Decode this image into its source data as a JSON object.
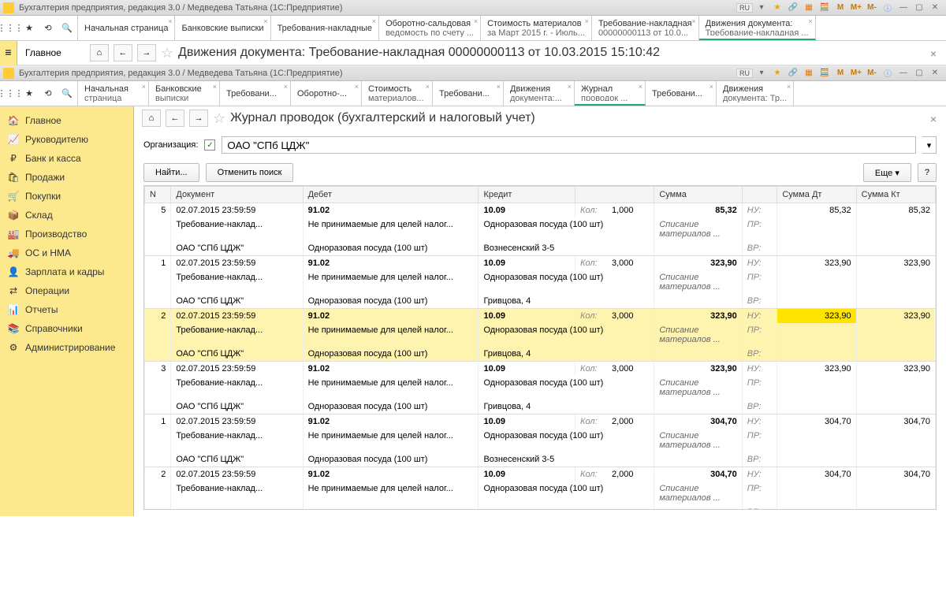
{
  "title1": "Бухгалтерия предприятия, редакция 3.0 / Медведева Татьяна  (1С:Предприятие)",
  "lang": "RU",
  "mbtns": [
    "M",
    "M+",
    "M-"
  ],
  "tabs1": [
    {
      "l1": "Начальная страница"
    },
    {
      "l1": "Банковские выписки"
    },
    {
      "l1": "Требования-накладные"
    },
    {
      "l1": "Оборотно-сальдовая",
      "l2": "ведомость по счету ..."
    },
    {
      "l1": "Стоимость материалов",
      "l2": "за Март 2015 г. - Июль..."
    },
    {
      "l1": "Требование-накладная",
      "l2": "00000000113 от 10.0..."
    },
    {
      "l1": "Движения документа:",
      "l2": "Требование-накладная ...",
      "active": true
    }
  ],
  "doc_title1": "Движения документа: Требование-накладная 00000000113 от 10.03.2015 15:10:42",
  "tabs2": [
    {
      "l1": "Начальная",
      "l2": "страница"
    },
    {
      "l1": "Банковские",
      "l2": "выписки"
    },
    {
      "l1": "Требовани..."
    },
    {
      "l1": "Оборотно-..."
    },
    {
      "l1": "Стоимость",
      "l2": "материалов..."
    },
    {
      "l1": "Требовани..."
    },
    {
      "l1": "Движения",
      "l2": "документа:..."
    },
    {
      "l1": "Журнал",
      "l2": "проводок ...",
      "active": true
    },
    {
      "l1": "Требовани..."
    },
    {
      "l1": "Движения",
      "l2": "документа: Тр..."
    }
  ],
  "doc_title2": "Журнал проводок (бухгалтерский и налоговый учет)",
  "sidebar_top": "Главное",
  "sidebar": [
    {
      "icon": "🏠",
      "label": "Главное"
    },
    {
      "icon": "📈",
      "label": "Руководителю"
    },
    {
      "icon": "₽",
      "label": "Банк и касса"
    },
    {
      "icon": "🛍",
      "label": "Продажи"
    },
    {
      "icon": "🛒",
      "label": "Покупки"
    },
    {
      "icon": "📦",
      "label": "Склад"
    },
    {
      "icon": "🏭",
      "label": "Производство"
    },
    {
      "icon": "🚚",
      "label": "ОС и НМА"
    },
    {
      "icon": "👤",
      "label": "Зарплата и кадры"
    },
    {
      "icon": "⇄",
      "label": "Операции"
    },
    {
      "icon": "📊",
      "label": "Отчеты"
    },
    {
      "icon": "📚",
      "label": "Справочники"
    },
    {
      "icon": "⚙",
      "label": "Администрирование"
    }
  ],
  "org_label": "Организация:",
  "org_value": "ОАО \"СПб ЦДЖ\"",
  "btn_find": "Найти...",
  "btn_cancel_find": "Отменить поиск",
  "btn_more": "Еще",
  "cols": {
    "n": "N",
    "doc": "Документ",
    "debit": "Дебет",
    "credit": "Кредит",
    "sum": "Сумма",
    "sumdt": "Сумма Дт",
    "sumkt": "Сумма Кт"
  },
  "labels": {
    "kol": "Кол:",
    "nu": "НУ:",
    "pr": "ПР:",
    "vr": "ВР:"
  },
  "rows": [
    {
      "n": "5",
      "date": "02.07.2015 23:59:59",
      "doc2": "Требование-наклад...",
      "doc3": "ОАО \"СПб ЦДЖ\"",
      "debit": "91.02",
      "debit2": "Не принимаемые для целей налог...",
      "debit3": "Одноразовая посуда (100 шт)",
      "credit": "10.09",
      "kol": "1,000",
      "credit2": "Одноразовая посуда (100 шт)",
      "credit3": "Вознесенский 3-5",
      "sum": "85,32",
      "sum2": "Списание материалов ...",
      "sumdt": "85,32",
      "sumkt": "85,32"
    },
    {
      "n": "1",
      "date": "02.07.2015 23:59:59",
      "doc2": "Требование-наклад...",
      "doc3": "ОАО \"СПб ЦДЖ\"",
      "debit": "91.02",
      "debit2": "Не принимаемые для целей налог...",
      "debit3": "Одноразовая посуда (100 шт)",
      "credit": "10.09",
      "kol": "3,000",
      "credit2": "Одноразовая посуда (100 шт)",
      "credit3": "Гривцова, 4",
      "sum": "323,90",
      "sum2": "Списание материалов ...",
      "sumdt": "323,90",
      "sumkt": "323,90"
    },
    {
      "n": "2",
      "hl": true,
      "date": "02.07.2015 23:59:59",
      "doc2": "Требование-наклад...",
      "doc3": "ОАО \"СПб ЦДЖ\"",
      "debit": "91.02",
      "debit2": "Не принимаемые для целей налог...",
      "debit3": "Одноразовая посуда (100 шт)",
      "credit": "10.09",
      "kol": "3,000",
      "credit2": "Одноразовая посуда (100 шт)",
      "credit3": "Гривцова, 4",
      "sum": "323,90",
      "sum2": "Списание материалов ...",
      "sumdt": "323,90",
      "sumkt": "323,90"
    },
    {
      "n": "3",
      "date": "02.07.2015 23:59:59",
      "doc2": "Требование-наклад...",
      "doc3": "ОАО \"СПб ЦДЖ\"",
      "debit": "91.02",
      "debit2": "Не принимаемые для целей налог...",
      "debit3": "Одноразовая посуда (100 шт)",
      "credit": "10.09",
      "kol": "3,000",
      "credit2": "Одноразовая посуда (100 шт)",
      "credit3": "Гривцова, 4",
      "sum": "323,90",
      "sum2": "Списание материалов ...",
      "sumdt": "323,90",
      "sumkt": "323,90"
    },
    {
      "n": "1",
      "date": "02.07.2015 23:59:59",
      "doc2": "Требование-наклад...",
      "doc3": "ОАО \"СПб ЦДЖ\"",
      "debit": "91.02",
      "debit2": "Не принимаемые для целей налог...",
      "debit3": "Одноразовая посуда (100 шт)",
      "credit": "10.09",
      "kol": "2,000",
      "credit2": "Одноразовая посуда (100 шт)",
      "credit3": "Вознесенский 3-5",
      "sum": "304,70",
      "sum2": "Списание материалов ...",
      "sumdt": "304,70",
      "sumkt": "304,70"
    },
    {
      "n": "2",
      "date": "02.07.2015 23:59:59",
      "doc2": "Требование-наклад...",
      "doc3": "",
      "debit": "91.02",
      "debit2": "Не принимаемые для целей налог...",
      "debit3": "",
      "credit": "10.09",
      "kol": "2,000",
      "credit2": "Одноразовая посуда (100 шт)",
      "credit3": "",
      "sum": "304,70",
      "sum2": "Списание материалов ...",
      "sumdt": "304,70",
      "sumkt": "304,70"
    }
  ]
}
